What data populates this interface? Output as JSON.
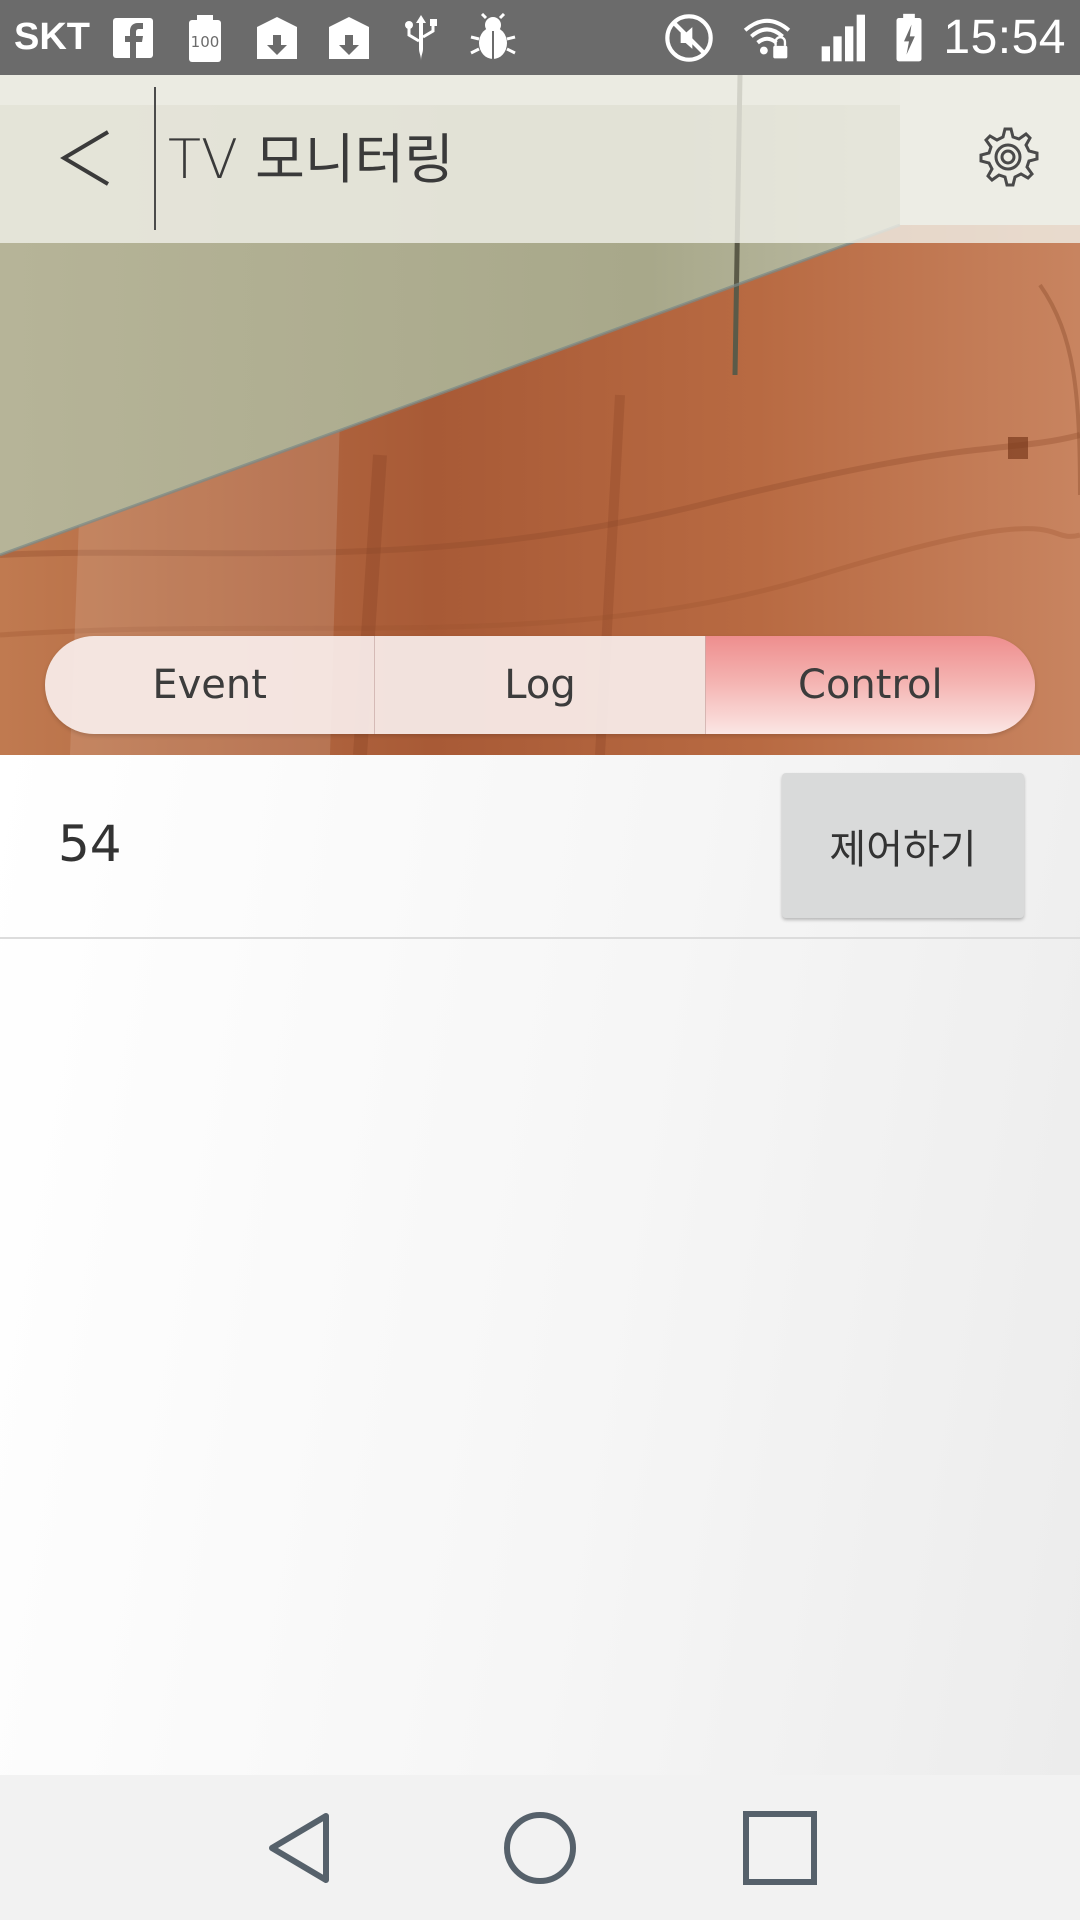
{
  "status_bar": {
    "carrier": "SKT",
    "battery_badge": "100",
    "clock": "15:54",
    "notification_icons": [
      "facebook-icon",
      "battery-saver-icon",
      "download-icon",
      "download-icon",
      "usb-icon",
      "debug-icon"
    ],
    "system_icons": [
      "mute-icon",
      "wifi-lock-icon",
      "signal-icon",
      "battery-charging-icon"
    ]
  },
  "app_bar": {
    "title": "TV 모니터링",
    "back_icon": "chevron-left-icon",
    "settings_icon": "gear-icon"
  },
  "tabs": [
    {
      "label": "Event",
      "active": false
    },
    {
      "label": "Log",
      "active": false
    },
    {
      "label": "Control",
      "active": true
    }
  ],
  "control": {
    "value": "54",
    "button_label": "제어하기"
  },
  "nav_bar": {
    "icons": [
      "back-triangle-icon",
      "home-circle-icon",
      "recents-square-icon"
    ]
  },
  "colors": {
    "status_bar": "#6b6b6b",
    "active_tab": "#ee8e8e",
    "nav_icon": "#56616b"
  }
}
